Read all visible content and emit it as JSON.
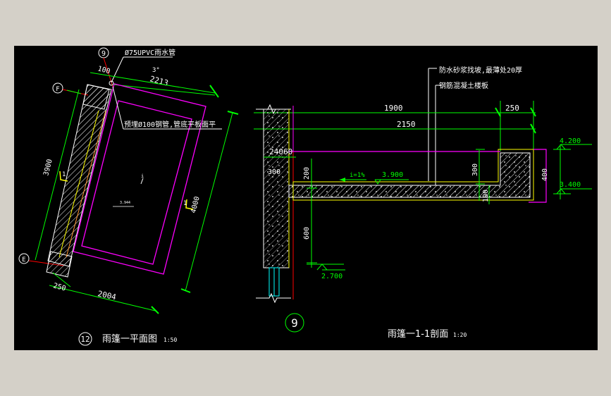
{
  "plan": {
    "grid_top": "9",
    "grid_f": "F",
    "grid_e": "E",
    "pipe_label": "Ø75UPVC雨水管",
    "dim_100": "100",
    "dim_2213": "2213",
    "angle": "3°",
    "embed_note": "预埋Ø100钢管,管底平板面平",
    "dim_3900": "3900",
    "dim_4000": "4000",
    "dim_250": "250",
    "dim_2004": "2004",
    "slope_mark": "i",
    "section_mark_1": "1",
    "section_mark_2": "1",
    "level_small": "3.944",
    "title_num": "12",
    "title": "雨篷一平面图",
    "scale": "1:50"
  },
  "section": {
    "note_1": "防水砂浆找坡,最薄处20厚",
    "note_2": "钢筋混凝土楼板",
    "dim_1900": "1900",
    "dim_250": "250",
    "dim_2150": "2150",
    "dim_240": "240",
    "dim_60": "60",
    "dim_300_left": "300",
    "dim_200": "200",
    "slope": "i=1%",
    "level_3900": "3.900",
    "dim_300": "300",
    "dim_100": "100",
    "dim_400": "400",
    "level_4200": "4.200",
    "level_3400": "3.400",
    "dim_600": "600",
    "level_2700": "2.700",
    "grid": "9",
    "title": "雨篷一1-1剖面",
    "scale": "1:20"
  },
  "colors": {
    "background": "#000000",
    "frame": "#d4d0c8",
    "dim": "#00ff00",
    "wall": "#ffff00",
    "magenta": "#ff00ff",
    "red": "#ff0000",
    "text": "#ffffff",
    "orange": "#ff9933",
    "cyan": "#00ffff"
  }
}
